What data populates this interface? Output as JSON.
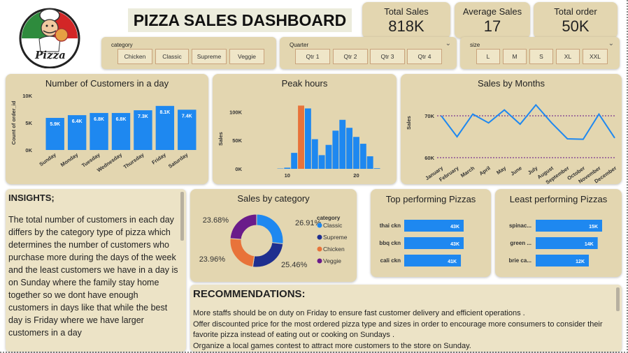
{
  "header": {
    "title": "PIZZA SALES DASHBOARD",
    "logo_text": "Pizza"
  },
  "kpis": [
    {
      "label": "Total Sales",
      "value": "818K"
    },
    {
      "label": "Average Sales",
      "value": "17"
    },
    {
      "label": "Total order",
      "value": "50K"
    }
  ],
  "slicers": {
    "category": {
      "label": "category",
      "options": [
        "Chicken",
        "Classic",
        "Supreme",
        "Veggie"
      ]
    },
    "quarter": {
      "label": "Quarter",
      "options": [
        "Qtr 1",
        "Qtr 2",
        "Qtr 3",
        "Qtr 4"
      ]
    },
    "size": {
      "label": "size",
      "options": [
        "L",
        "M",
        "S",
        "XL",
        "XXL"
      ]
    }
  },
  "colors": {
    "primary": "#1e88f0",
    "accent": "#e8733a",
    "card": "#e3d6b0",
    "navy": "#1f2f8f",
    "purple": "#6a1b8a"
  },
  "chart_data": [
    {
      "type": "bar",
      "title": "Number of Customers in a day",
      "ylabel": "Count of order_id",
      "categories": [
        "Sunday",
        "Monday",
        "Tuesday",
        "Wednesday",
        "Thursday",
        "Friday",
        "Saturday"
      ],
      "values": [
        5.9,
        6.4,
        6.8,
        6.8,
        7.3,
        8.1,
        7.4
      ],
      "data_labels": [
        "5.9K",
        "6.4K",
        "6.8K",
        "6.8K",
        "7.3K",
        "8.1K",
        "7.4K"
      ],
      "yticks": [
        "0K",
        "5K",
        "10K"
      ],
      "ylim": [
        0,
        10
      ]
    },
    {
      "type": "bar",
      "title": "Peak hours",
      "ylabel": "Sales",
      "x": [
        9,
        10,
        11,
        12,
        13,
        14,
        15,
        16,
        17,
        18,
        19,
        20,
        21,
        22,
        23
      ],
      "values": [
        0.5,
        2,
        28,
        111,
        106,
        52,
        24,
        42,
        67,
        86,
        72,
        56,
        44,
        22,
        1
      ],
      "highlight_index": 3,
      "xticks": [
        "10",
        "20"
      ],
      "yticks": [
        "0K",
        "50K",
        "100K"
      ],
      "ylim": [
        0,
        120
      ]
    },
    {
      "type": "line",
      "title": "Sales by Months",
      "ylabel": "Sales",
      "categories": [
        "January",
        "February",
        "March",
        "April",
        "May",
        "June",
        "July",
        "August",
        "September",
        "October",
        "November",
        "December"
      ],
      "values": [
        70.0,
        65.0,
        70.4,
        68.3,
        71.4,
        68.0,
        72.6,
        68.3,
        64.5,
        64.4,
        70.4,
        64.7
      ],
      "average": 68.3,
      "yticks": [
        "60K",
        "70K"
      ],
      "ylim": [
        59,
        75
      ]
    },
    {
      "type": "pie",
      "title": "Sales by category",
      "legend_title": "category",
      "labels": [
        "Classic",
        "Supreme",
        "Chicken",
        "Veggie"
      ],
      "values": [
        26.91,
        25.46,
        23.96,
        23.68
      ],
      "value_labels": [
        "26.91%",
        "25.46%",
        "23.96%",
        "23.68%"
      ],
      "colors": [
        "#1e88f0",
        "#1f2f8f",
        "#e8733a",
        "#6a1b8a"
      ]
    },
    {
      "type": "bar",
      "title": "Top performing Pizzas",
      "orientation": "horizontal",
      "categories": [
        "thai ckn",
        "bbq ckn",
        "cali ckn"
      ],
      "values": [
        43,
        43,
        41
      ],
      "data_labels": [
        "43K",
        "43K",
        "41K"
      ]
    },
    {
      "type": "bar",
      "title": "Least performing Pizzas",
      "orientation": "horizontal",
      "categories": [
        "spinac...",
        "green ...",
        "brie ca..."
      ],
      "values": [
        15,
        14,
        12
      ],
      "data_labels": [
        "15K",
        "14K",
        "12K"
      ]
    }
  ],
  "insights": {
    "heading": "INSIGHTS;",
    "body": "The total number of customers in each day differs by the category type of pizza which determines the number of customers who purchase more during the days of the week and  the least customers we have in a day is on Sunday where the family stay home together so we dont have enough customers in days like that while the best day is Friday where we have larger customers in a day"
  },
  "recommendations": {
    "heading": "RECOMMENDATIONS:",
    "lines": [
      "More staffs should be on duty on Friday to ensure fast customer delivery and efficient operations .",
      "Offer discounted price for the most ordered pizza type and sizes in order to encourage more consumers to consider their favorite pizza instead of eating out or cooking on Sundays .",
      "Organize a local games contest to attract more customers to the store on Sunday."
    ]
  }
}
